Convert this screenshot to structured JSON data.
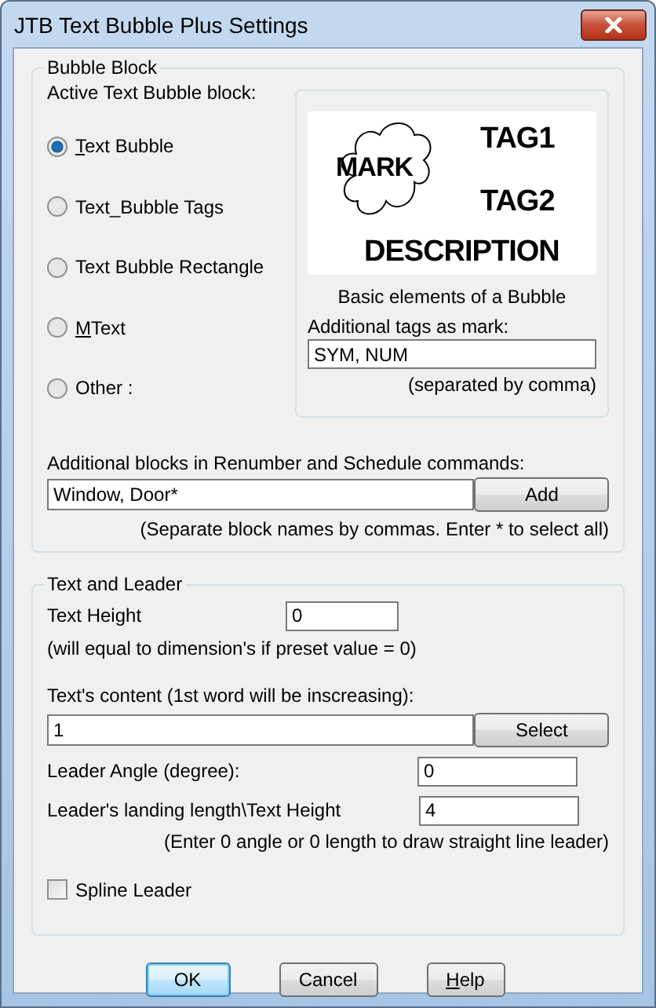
{
  "window": {
    "title": "JTB Text Bubble Plus Settings"
  },
  "bubble_block": {
    "title": "Bubble Block",
    "prompt": "Active Text Bubble block:",
    "options": [
      {
        "label": "Text Bubble",
        "selected": true,
        "underline_first": true
      },
      {
        "label": "Text_Bubble  Tags",
        "selected": false,
        "underline_first": false
      },
      {
        "label": "Text Bubble Rectangle",
        "selected": false,
        "underline_first": false
      },
      {
        "label": "MText",
        "selected": false,
        "underline_first": true
      },
      {
        "label": "Other :",
        "selected": false,
        "underline_first": false
      }
    ],
    "preview": {
      "mark": "MARK",
      "tags": [
        "TAG1",
        "TAG2"
      ],
      "description": "DESCRIPTION",
      "caption": "Basic elements of a Bubble"
    },
    "tags_label": "Additional tags as mark:",
    "tags_value": "SYM, NUM",
    "tags_note": "(separated by comma)",
    "blocks_label": "Additional blocks in Renumber and Schedule commands:",
    "blocks_value": "Window, Door*",
    "add_button": "Add",
    "blocks_note": "(Separate block names by commas. Enter * to select all)"
  },
  "text_and_leader": {
    "title": "Text and Leader",
    "text_height": {
      "label": "Text Height",
      "value": "0"
    },
    "height_note": "(will equal to dimension's if preset value = 0)",
    "content": {
      "label": "Text's content (1st word will be inscreasing):",
      "value": "1"
    },
    "select_button": "Select",
    "leader_angle": {
      "label": "Leader Angle (degree):",
      "value": "0"
    },
    "landing": {
      "label": "Leader's landing length\\Text Height",
      "value": "4"
    },
    "leader_note": "(Enter 0 angle or 0 length to draw straight line leader)",
    "spline": {
      "label": "Spline Leader",
      "checked": false
    }
  },
  "buttons": [
    {
      "label": "OK",
      "default": true,
      "underline_first": false
    },
    {
      "label": "Cancel",
      "default": false,
      "underline_first": false
    },
    {
      "label": "Help",
      "default": false,
      "underline_first": true
    }
  ]
}
